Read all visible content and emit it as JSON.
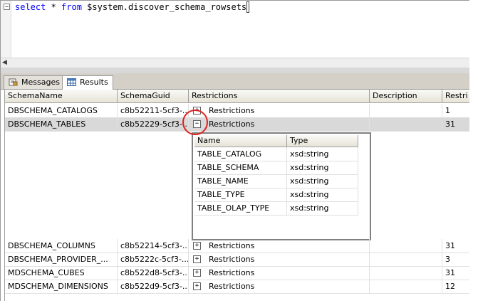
{
  "editor": {
    "collapse_glyph": "−",
    "kw_select": "select",
    "star": " * ",
    "kw_from": "from",
    "table_ref": " $system.discover_schema_rowsets"
  },
  "tabs": [
    {
      "label": "Messages",
      "icon": "messages-icon"
    },
    {
      "label": "Results",
      "icon": "grid-icon"
    }
  ],
  "grid": {
    "columns": [
      "SchemaName",
      "SchemaGuid",
      "Restrictions",
      "Description",
      "Restri"
    ],
    "rows": [
      {
        "name": "DBSCHEMA_CATALOGS",
        "guid": "c8b52211-5cf3-...",
        "expander": "+",
        "restrictions": "Restrictions",
        "description": "",
        "restri": "1"
      },
      {
        "name": "DBSCHEMA_TABLES",
        "guid": "c8b52229-5cf3-...",
        "expander": "−",
        "restrictions": "Restrictions",
        "description": "",
        "restri": "31"
      },
      {
        "name": "DBSCHEMA_COLUMNS",
        "guid": "c8b52214-5cf3-...",
        "expander": "+",
        "restrictions": "Restrictions",
        "description": "",
        "restri": "31"
      },
      {
        "name": "DBSCHEMA_PROVIDER_...",
        "guid": "c8b5222c-5cf3-...",
        "expander": "+",
        "restrictions": "Restrictions",
        "description": "",
        "restri": "3"
      },
      {
        "name": "MDSCHEMA_CUBES",
        "guid": "c8b522d8-5cf3-...",
        "expander": "+",
        "restrictions": "Restrictions",
        "description": "",
        "restri": "31"
      },
      {
        "name": "MDSCHEMA_DIMENSIONS",
        "guid": "c8b522d9-5cf3-...",
        "expander": "+",
        "restrictions": "Restrictions",
        "description": "",
        "restri": "12"
      }
    ]
  },
  "subgrid": {
    "columns": [
      "Name",
      "Type"
    ],
    "rows": [
      {
        "name": "TABLE_CATALOG",
        "type": "xsd:string"
      },
      {
        "name": "TABLE_SCHEMA",
        "type": "xsd:string"
      },
      {
        "name": "TABLE_NAME",
        "type": "xsd:string"
      },
      {
        "name": "TABLE_TYPE",
        "type": "xsd:string"
      },
      {
        "name": "TABLE_OLAP_TYPE",
        "type": "xsd:string"
      }
    ]
  },
  "colors": {
    "keyword": "#0000ff",
    "highlight_circle": "#e02020",
    "selected_row": "#d9d9d9"
  }
}
